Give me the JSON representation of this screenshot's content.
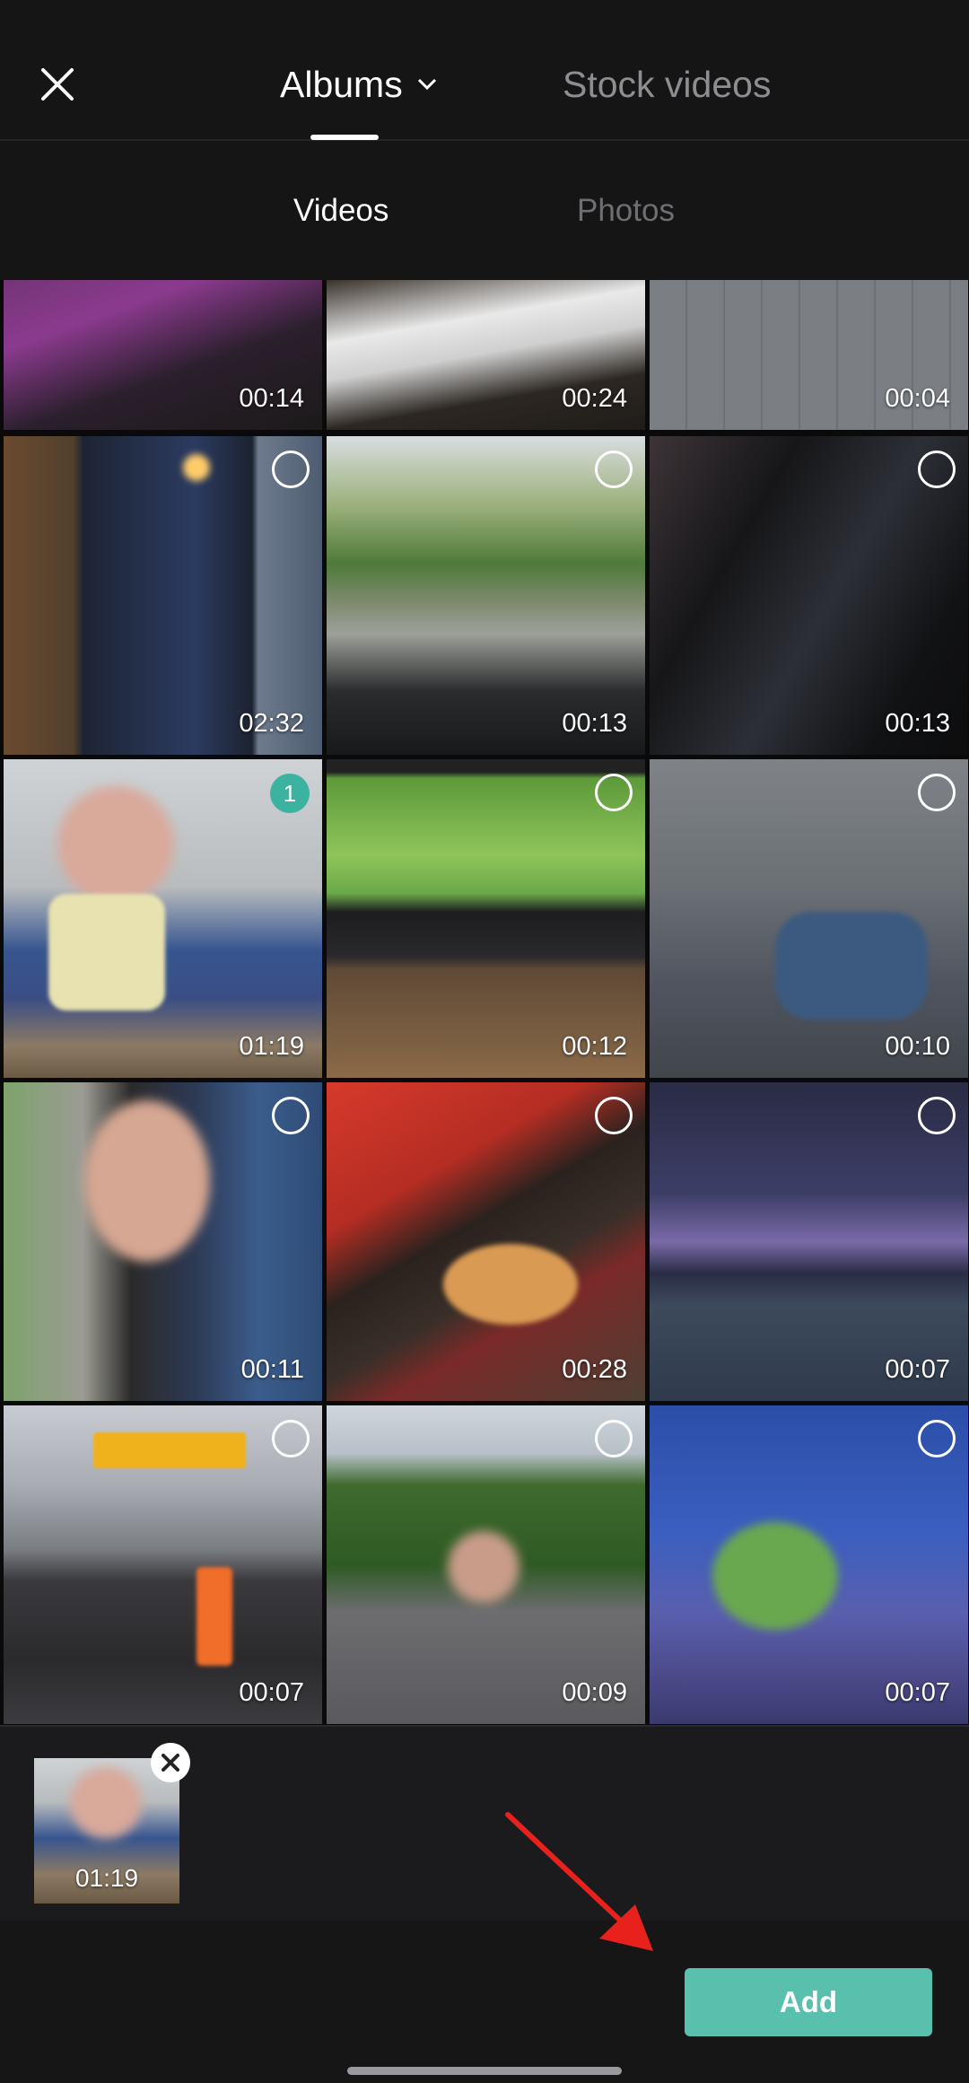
{
  "header": {
    "tabs": [
      {
        "label": "Albums",
        "active": true,
        "has_dropdown": true
      },
      {
        "label": "Stock videos",
        "active": false
      }
    ],
    "close_icon": "close-icon"
  },
  "subtabs": [
    {
      "label": "Videos",
      "active": true
    },
    {
      "label": "Photos",
      "active": false
    }
  ],
  "media": [
    {
      "duration": "00:14",
      "selected_index": null
    },
    {
      "duration": "00:24",
      "selected_index": null
    },
    {
      "duration": "00:04",
      "selected_index": null
    },
    {
      "duration": "02:32",
      "selected_index": null
    },
    {
      "duration": "00:13",
      "selected_index": null
    },
    {
      "duration": "00:13",
      "selected_index": null
    },
    {
      "duration": "01:19",
      "selected_index": "1"
    },
    {
      "duration": "00:12",
      "selected_index": null
    },
    {
      "duration": "00:10",
      "selected_index": null
    },
    {
      "duration": "00:11",
      "selected_index": null
    },
    {
      "duration": "00:28",
      "selected_index": null
    },
    {
      "duration": "00:07",
      "selected_index": null
    },
    {
      "duration": "00:07",
      "selected_index": null
    },
    {
      "duration": "00:09",
      "selected_index": null
    },
    {
      "duration": "00:07",
      "selected_index": null
    }
  ],
  "selection_tray": {
    "items": [
      {
        "duration": "01:19"
      }
    ]
  },
  "footer": {
    "add_label": "Add"
  },
  "colors": {
    "accent": "#58c0ad",
    "badge": "#3bb3a0",
    "background": "#111112",
    "annotation_arrow": "#e8211c"
  }
}
